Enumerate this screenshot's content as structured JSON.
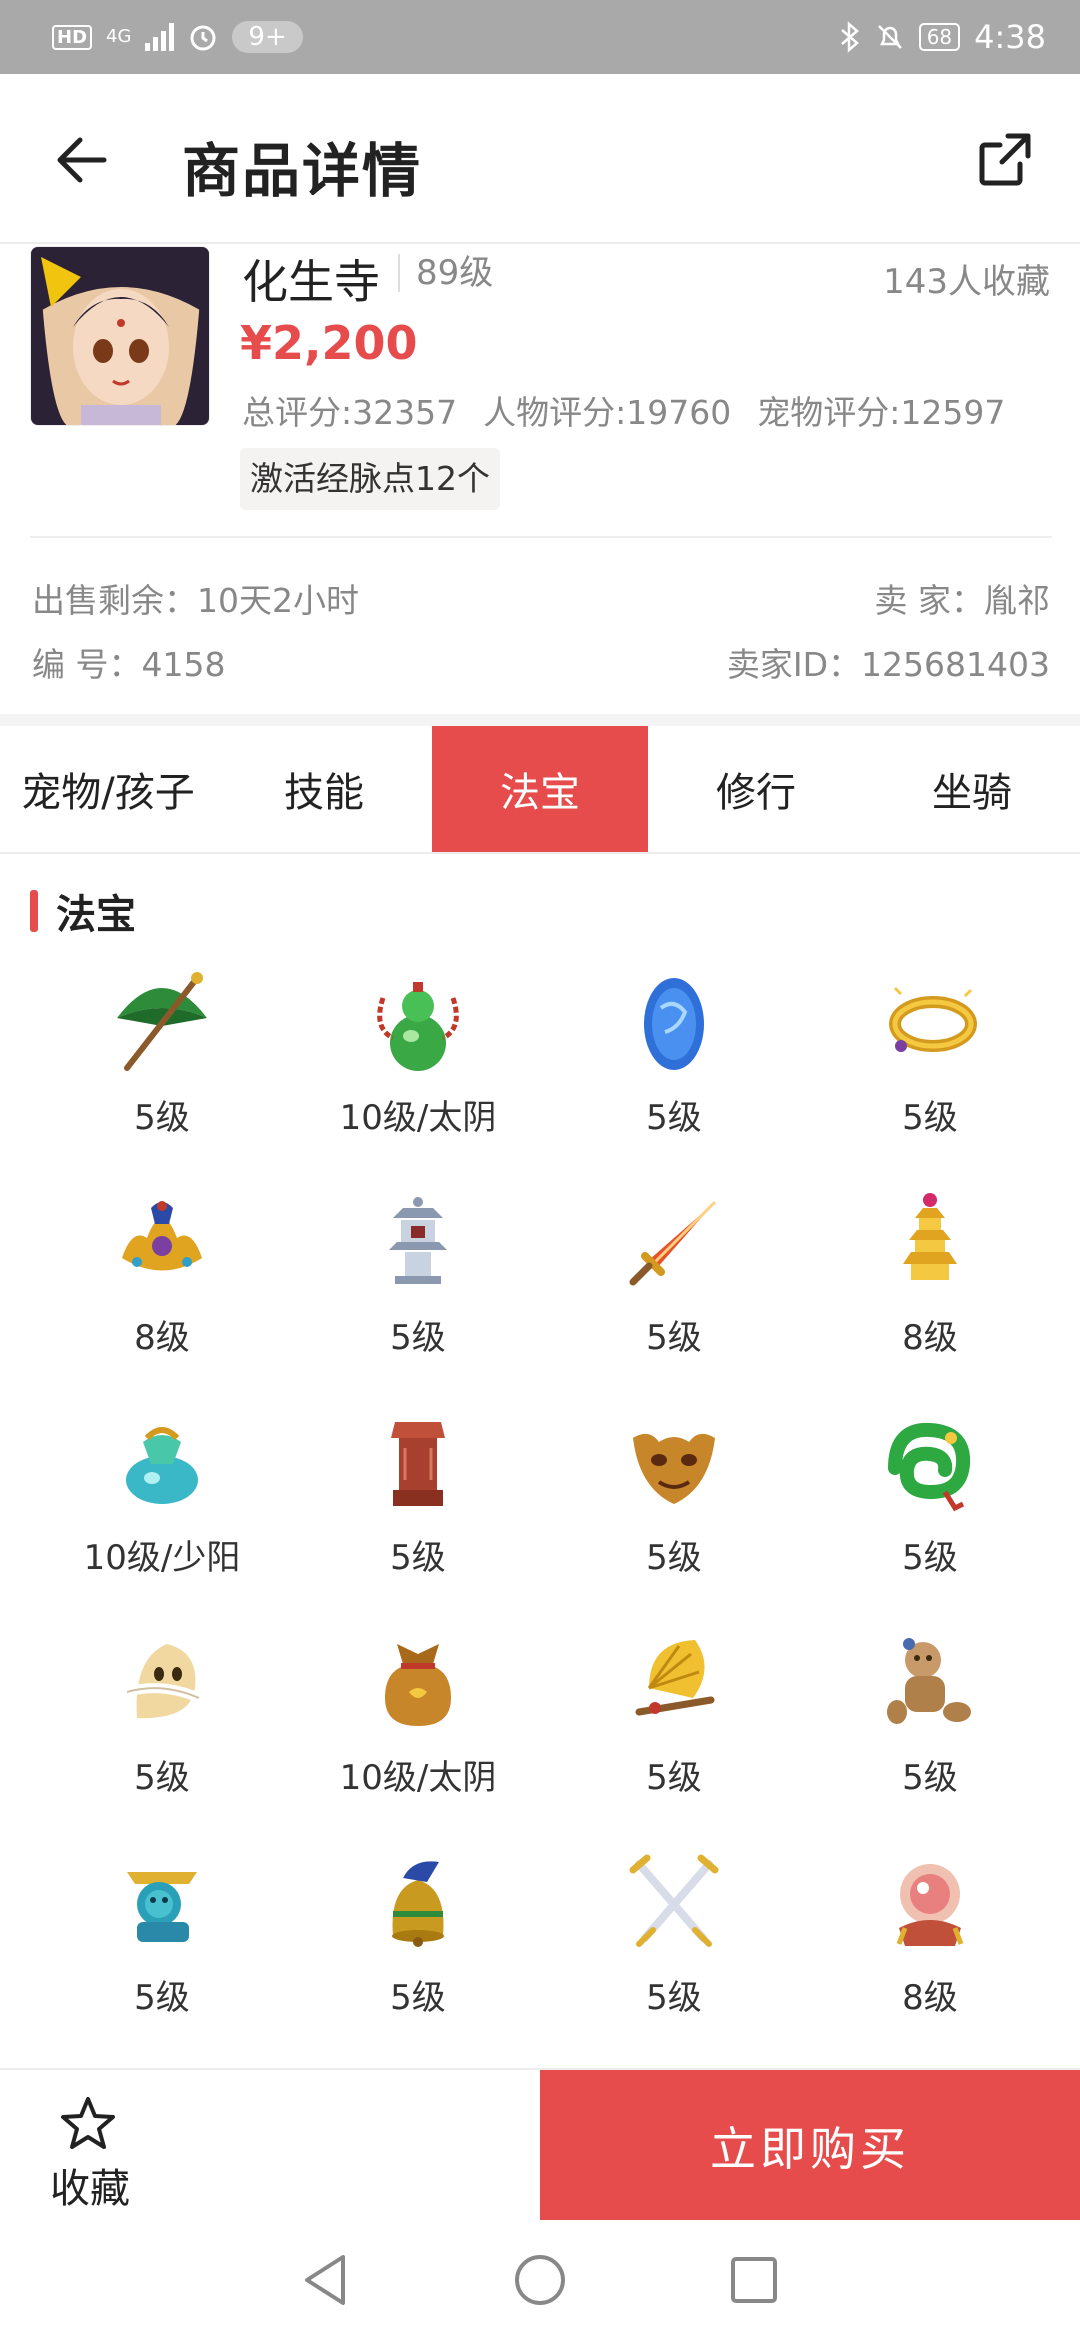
{
  "status_bar": {
    "hd": "HD",
    "network": "4G",
    "notifications": "9+",
    "battery": "68",
    "time": "4:38"
  },
  "header": {
    "title": "商品详情"
  },
  "product": {
    "name": "化生寺",
    "level": "89级",
    "favorites": "143人收藏",
    "price": "¥2,200",
    "scores": [
      "总评分:32357",
      "人物评分:19760",
      "宠物评分:12597"
    ],
    "tag": "激活经脉点12个",
    "sale_remaining": "出售剩余：10天2小时",
    "seller": "卖 家：胤祁",
    "serial": "编 号：4158",
    "seller_id": "卖家ID：125681403"
  },
  "tabs": [
    {
      "label": "宠物/孩子",
      "active": false
    },
    {
      "label": "技能",
      "active": false
    },
    {
      "label": "法宝",
      "active": true
    },
    {
      "label": "修行",
      "active": false
    },
    {
      "label": "坐骑",
      "active": false
    }
  ],
  "section": {
    "title": "法宝"
  },
  "items": [
    {
      "icon": "umbrella-icon",
      "level": "5级"
    },
    {
      "icon": "gourd-icon",
      "level": "10级/太阴"
    },
    {
      "icon": "blue-stone-icon",
      "level": "5级"
    },
    {
      "icon": "golden-rope-icon",
      "level": "5级"
    },
    {
      "icon": "crown-ornament-icon",
      "level": "8级"
    },
    {
      "icon": "stone-lantern-icon",
      "level": "5级"
    },
    {
      "icon": "flame-sword-icon",
      "level": "5级"
    },
    {
      "icon": "golden-pagoda-icon",
      "level": "8级"
    },
    {
      "icon": "jade-bottle-icon",
      "level": "10级/少阳"
    },
    {
      "icon": "seal-stamp-icon",
      "level": "5级"
    },
    {
      "icon": "demon-mask-icon",
      "level": "5级"
    },
    {
      "icon": "green-dragon-icon",
      "level": "5级"
    },
    {
      "icon": "ghost-charm-icon",
      "level": "5级"
    },
    {
      "icon": "treasure-bag-icon",
      "level": "10级/太阴"
    },
    {
      "icon": "fan-sword-icon",
      "level": "5级"
    },
    {
      "icon": "ragdoll-icon",
      "level": "5级"
    },
    {
      "icon": "lion-statue-icon",
      "level": "5级"
    },
    {
      "icon": "bronze-bell-icon",
      "level": "5级"
    },
    {
      "icon": "crossed-swords-icon",
      "level": "5级"
    },
    {
      "icon": "crystal-orb-icon",
      "level": "8级"
    }
  ],
  "bottom_bar": {
    "favorite_label": "收藏",
    "buy_label": "立即购买"
  },
  "colors": {
    "accent": "#e64c4c",
    "status_bar": "#a9a9a9",
    "muted_text": "#888888"
  }
}
